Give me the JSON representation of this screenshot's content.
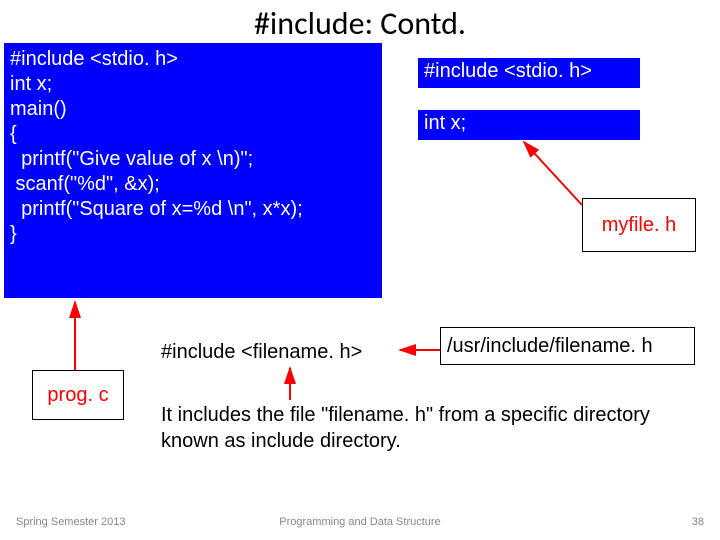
{
  "title": "#include: Contd.",
  "code": {
    "l1": "#include <stdio. h>",
    "l2": "int x;",
    "l3": "",
    "l4": "main()",
    "l5": "{",
    "l6": "  printf(\"Give value of x \\n)\";",
    "l7": " scanf(\"%d\", &x);",
    "l8": "  printf(\"Square of x=%d \\n\", x*x);",
    "l9": "}"
  },
  "right": {
    "stdio": "#include <stdio. h>",
    "intx": "int x;",
    "myfile": "myfile. h"
  },
  "prog": "prog. c",
  "include_filename": "#include <filename. h>",
  "usr_path": "/usr/include/filename. h",
  "explain": "It includes the file \"filename. h\" from a specific directory known as include directory.",
  "footer": {
    "left": "Spring Semester 2013",
    "center": "Programming and Data Structure",
    "right": "38"
  },
  "colors": {
    "code_bg": "#0000ff",
    "arrow": "#ff0000"
  }
}
